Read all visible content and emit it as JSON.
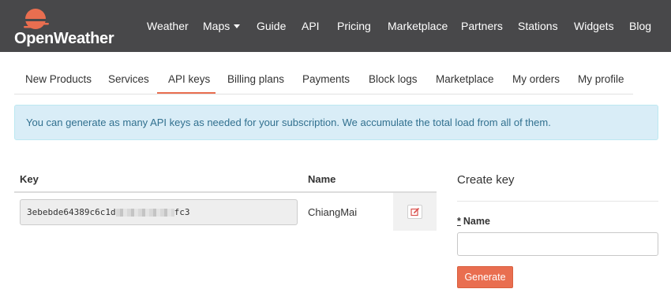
{
  "brand": {
    "name": "OpenWeather",
    "accent": "#e96e50",
    "navbar_bg": "#48484a"
  },
  "nav": {
    "items": [
      "Weather",
      "Maps",
      "Guide",
      "API",
      "Pricing",
      "Marketplace",
      "Partners",
      "Stations",
      "Widgets",
      "Blog"
    ]
  },
  "tabs": {
    "items": [
      "New Products",
      "Services",
      "API keys",
      "Billing plans",
      "Payments",
      "Block logs",
      "Marketplace",
      "My orders",
      "My profile"
    ],
    "active": "API keys"
  },
  "alert": {
    "text": "You can generate as many API keys as needed for your subscription. We accumulate the total load from all of them."
  },
  "keys_table": {
    "columns": [
      "Key",
      "Name"
    ],
    "rows": [
      {
        "key_prefix": "3ebebde64389c6c1d",
        "key_suffix": "fc3",
        "name": "ChiangMai",
        "action_icon": "edit-icon"
      }
    ]
  },
  "create_key": {
    "title": "Create key",
    "required_mark": "*",
    "name_label": "Name",
    "name_value": "",
    "generate_label": "Generate"
  }
}
